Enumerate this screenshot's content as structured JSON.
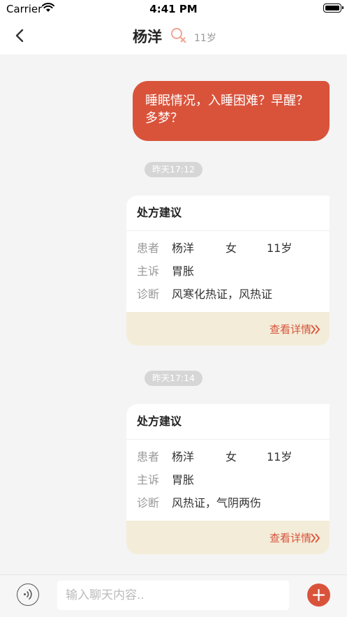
{
  "status_bar": {
    "carrier": "Carrier",
    "time": "4:41 PM"
  },
  "nav": {
    "patient_name": "杨洋",
    "age": "11岁"
  },
  "message": {
    "text": "睡眠情况，入睡困难？早醒？多梦？"
  },
  "prescriptions": [
    {
      "timestamp": "昨天17:12",
      "title": "处方建议",
      "patient_label": "患者",
      "patient_name": "杨洋",
      "gender": "女",
      "age": "11岁",
      "complaint_label": "主诉",
      "complaint": "胃胀",
      "diagnosis_label": "诊断",
      "diagnosis": "风寒化热证，风热证",
      "detail_link": "查看详情"
    },
    {
      "timestamp": "昨天17:14",
      "title": "处方建议",
      "patient_label": "患者",
      "patient_name": "杨洋",
      "gender": "女",
      "age": "11岁",
      "complaint_label": "主诉",
      "complaint": "胃胀",
      "diagnosis_label": "诊断",
      "diagnosis": "风热证，气阴两伤",
      "detail_link": "查看详情"
    }
  ],
  "input_bar": {
    "placeholder": "输入聊天内容.."
  },
  "colors": {
    "accent": "#d9533b",
    "card_footer": "#f3ecd8",
    "background": "#f4f4f4"
  },
  "icons": [
    "wifi-icon",
    "battery-icon",
    "back-arrow-icon",
    "female-icon",
    "chevron-double-right-icon",
    "voice-icon",
    "plus-icon"
  ]
}
